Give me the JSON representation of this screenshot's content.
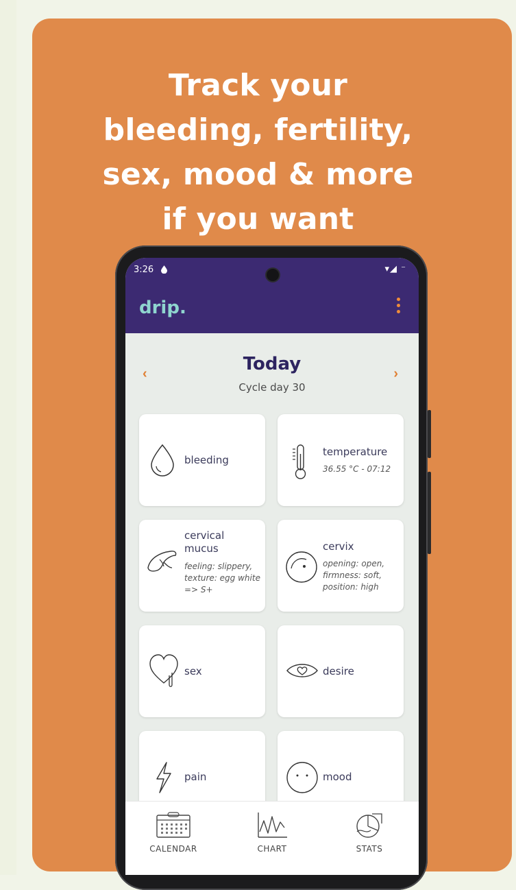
{
  "headline": [
    "Track your",
    "bleeding, fertility,",
    "sex, mood & more",
    "if you want"
  ],
  "status": {
    "time": "3:26",
    "right": "▾◢ ⁻"
  },
  "app": {
    "logo": "drip."
  },
  "day": {
    "title": "Today",
    "cycle_day": "Cycle day 30",
    "prev": "‹",
    "next": "›"
  },
  "tiles": {
    "bleeding": {
      "label": "bleeding"
    },
    "temperature": {
      "label": "temperature",
      "detail": "36.55 °C - 07:12"
    },
    "mucus": {
      "label": "cervical mucus",
      "detail": "feeling: slippery, texture: egg white => S+"
    },
    "cervix": {
      "label": "cervix",
      "detail": "opening: open, firmness: soft, position: high"
    },
    "sex": {
      "label": "sex"
    },
    "desire": {
      "label": "desire"
    },
    "pain": {
      "label": "pain"
    },
    "mood": {
      "label": "mood"
    }
  },
  "bottom_nav": {
    "calendar": "CALENDAR",
    "chart": "CHART",
    "stats": "STATS"
  },
  "colors": {
    "card": "#e08a4a",
    "appbar": "#3c2a72",
    "accent": "#e07f33",
    "logo": "#8fd5cf"
  }
}
